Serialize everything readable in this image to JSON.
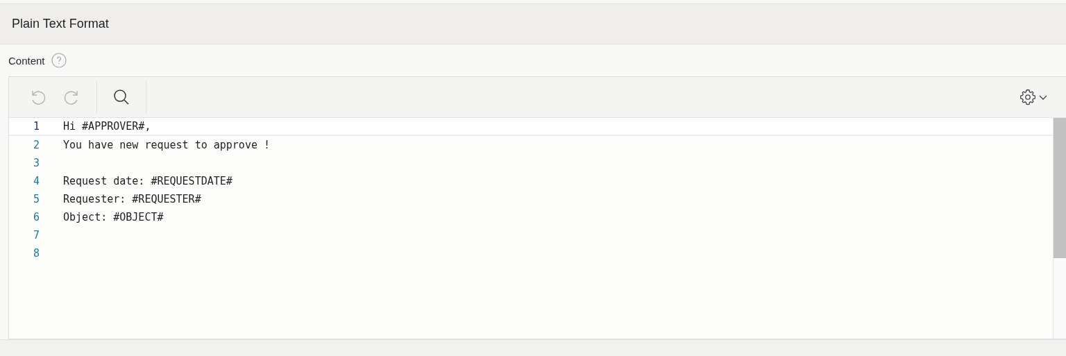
{
  "region": {
    "title": "Plain Text Format"
  },
  "field": {
    "label": "Content"
  },
  "toolbar": {
    "undo": {
      "disabled": true
    },
    "redo": {
      "disabled": true
    }
  },
  "editor": {
    "lines": [
      {
        "number": "1",
        "text": "Hi #APPROVER#,",
        "active": true
      },
      {
        "number": "2",
        "text": "You have new request to approve !",
        "active": false
      },
      {
        "number": "3",
        "active": false
      },
      {
        "number": "4",
        "text": "Request date: #REQUESTDATE#",
        "active": false
      },
      {
        "number": "5",
        "text": "Requester: #REQUESTER#",
        "active": false
      },
      {
        "number": "6",
        "text": "Object: #OBJECT#",
        "active": false
      },
      {
        "number": "7",
        "active": false
      },
      {
        "number": "8",
        "active": false
      }
    ]
  }
}
